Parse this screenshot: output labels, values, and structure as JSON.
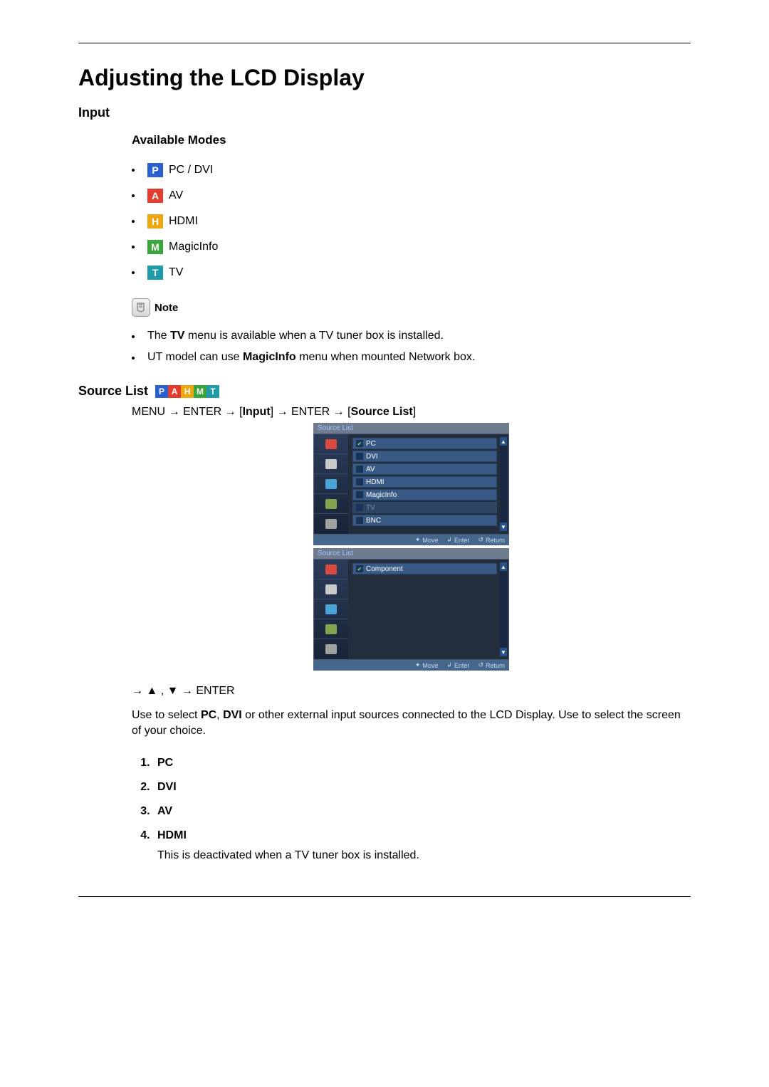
{
  "title": "Adjusting the LCD Display",
  "section_input": "Input",
  "available_modes_heading": "Available Modes",
  "modes": [
    {
      "letter": "P",
      "bg": "#2a5fd0",
      "label": "PC / DVI"
    },
    {
      "letter": "A",
      "bg": "#e43d2e",
      "label": "AV"
    },
    {
      "letter": "H",
      "bg": "#f0a70f",
      "label": "HDMI"
    },
    {
      "letter": "M",
      "bg": "#3aa53a",
      "label": "MagicInfo"
    },
    {
      "letter": "T",
      "bg": "#1e9aa8",
      "label": "TV"
    }
  ],
  "note_label": "Note",
  "notes": {
    "tv_pre": "The ",
    "tv_bold": "TV",
    "tv_post": " menu is available when a TV tuner box is installed.",
    "ut_pre": "UT model can use ",
    "ut_bold": "MagicInfo",
    "ut_post": " menu when mounted Network box."
  },
  "source_list_label": "Source List",
  "menu_path": {
    "p1": "MENU → ENTER → [",
    "p2": "Input",
    "p3": "] → ENTER → [",
    "p4": "Source List",
    "p5": "]"
  },
  "osd": {
    "title": "Source List",
    "items1": [
      {
        "label": "PC",
        "checked": true
      },
      {
        "label": "DVI"
      },
      {
        "label": "AV"
      },
      {
        "label": "HDMI"
      },
      {
        "label": "MagicInfo"
      },
      {
        "label": "TV",
        "disabled": true
      },
      {
        "label": "BNC"
      }
    ],
    "items2": [
      {
        "label": "Component",
        "checked": true
      }
    ],
    "foot_move": "Move",
    "foot_enter": "Enter",
    "foot_return": "Return"
  },
  "step_nav": "→ ▲ , ▼ → ENTER",
  "description_pre": "Use to select ",
  "description_b1": "PC",
  "description_mid1": ", ",
  "description_b2": "DVI",
  "description_post": " or other external input sources connected to the LCD Display. Use to select the screen of your choice.",
  "enum": [
    {
      "label": "PC"
    },
    {
      "label": "DVI"
    },
    {
      "label": "AV"
    },
    {
      "label": "HDMI",
      "sub": "This is deactivated when a TV tuner box is installed."
    }
  ],
  "side_icon_colors": [
    "#d84b3e",
    "#c9c9c9",
    "#4aa3d6",
    "#7fa64d",
    "#a0a0a0"
  ]
}
